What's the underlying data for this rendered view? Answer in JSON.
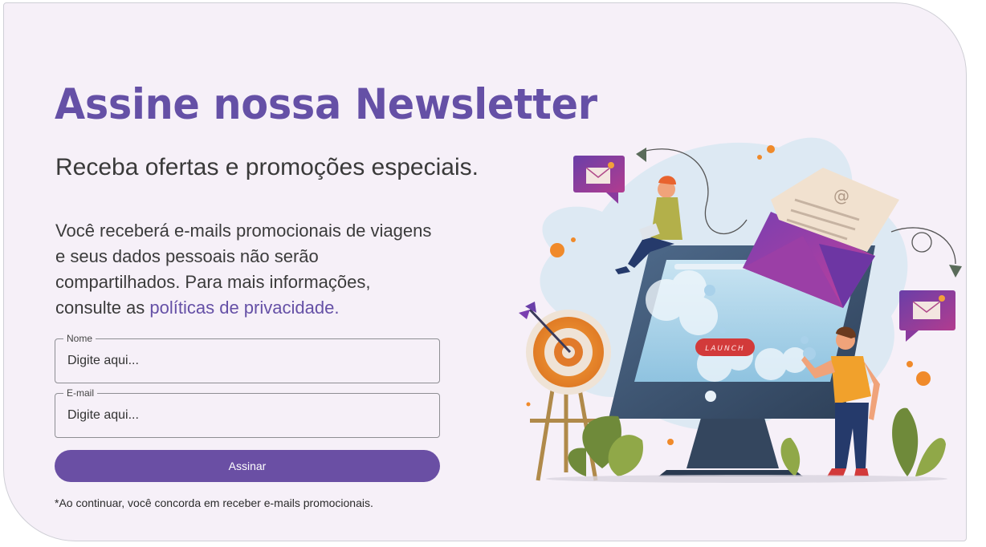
{
  "header": {
    "title": "Assine nossa Newsletter",
    "subtitle": "Receba ofertas e promoções especiais."
  },
  "description": {
    "text": "Você receberá e-mails promocionais de viagens e seus dados pessoais não serão compartilhados. Para mais informações, consulte as ",
    "link_label": "políticas de privacidade."
  },
  "form": {
    "name": {
      "label": "Nome",
      "placeholder": "Digite aqui..."
    },
    "email": {
      "label": "E-mail",
      "placeholder": "Digite aqui..."
    },
    "submit_label": "Assinar",
    "disclaimer": "*Ao continuar, você concorda em receber e-mails promocionais."
  },
  "illustration": {
    "launch_label": "LAUNCH",
    "email_at_symbol": "@"
  },
  "colors": {
    "accent": "#6550a6",
    "button": "#6a4fa4",
    "background": "#f6f0f8"
  }
}
